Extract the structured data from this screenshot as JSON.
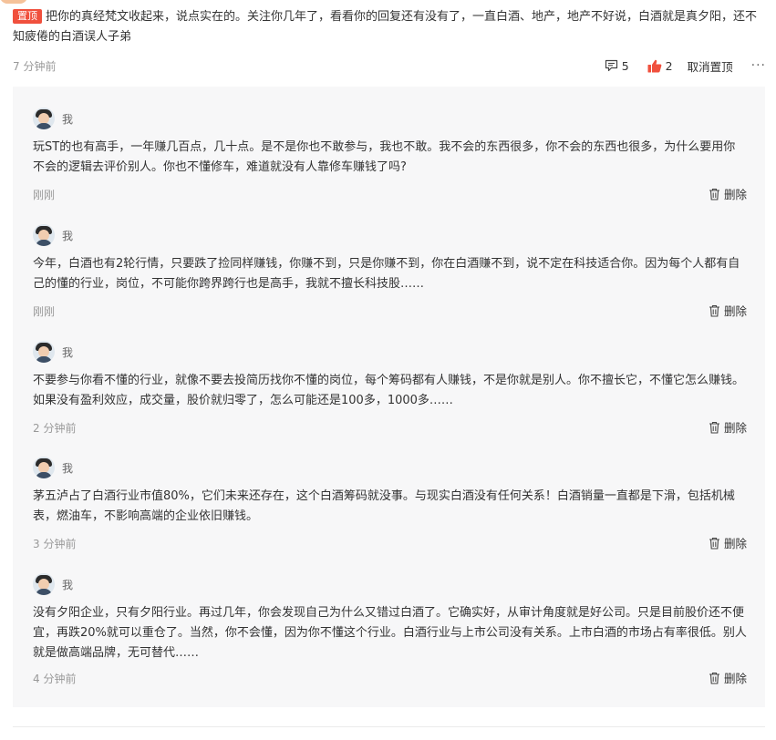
{
  "post": {
    "pin_label": "置顶",
    "text": "把你的真经梵文收起来，说点实在的。关注你几年了，看看你的回复还有没有了，一直白酒、地产，地产不好说，白酒就是真夕阳，还不知疲倦的白酒误人子弟",
    "time": "7 分钟前",
    "comment_count": "5",
    "like_count": "2",
    "unpin_label": "取消置顶",
    "more_label": "···",
    "icons": {
      "comment": "comment-icon",
      "like": "thumbs-up-icon",
      "more": "more-dots-icon"
    },
    "like_color": "#f0503d"
  },
  "replies": [
    {
      "name": "我",
      "text": "玩ST的也有高手，一年赚几百点，几十点。是不是你也不敢参与，我也不敢。我不会的东西很多，你不会的东西也很多，为什么要用你不会的逻辑去评价别人。你也不懂修车，难道就没有人靠修车赚钱了吗?",
      "time": "刚刚",
      "delete_label": "删除"
    },
    {
      "name": "我",
      "text": "今年，白酒也有2轮行情，只要跌了捡同样赚钱，你赚不到，只是你赚不到，你在白酒赚不到，说不定在科技适合你。因为每个人都有自己的懂的行业，岗位，不可能你跨界跨行也是高手，我就不擅长科技股……",
      "time": "刚刚",
      "delete_label": "删除"
    },
    {
      "name": "我",
      "text": "不要参与你看不懂的行业，就像不要去投简历找你不懂的岗位，每个筹码都有人赚钱，不是你就是别人。你不擅长它，不懂它怎么赚钱。如果没有盈利效应，成交量，股价就归零了，怎么可能还是100多，1000多……",
      "time": "2 分钟前",
      "delete_label": "删除"
    },
    {
      "name": "我",
      "text": "茅五泸占了白酒行业市值80%，它们未来还存在，这个白酒筹码就没事。与现实白酒没有任何关系！白酒销量一直都是下滑，包括机械表，燃油车，不影响高端的企业依旧赚钱。",
      "time": "3 分钟前",
      "delete_label": "删除"
    },
    {
      "name": "我",
      "text": "没有夕阳企业，只有夕阳行业。再过几年，你会发现自己为什么又错过白酒了。它确实好，从审计角度就是好公司。只是目前股价还不便宜，再跌20%就可以重仓了。当然，你不会懂，因为你不懂这个行业。白酒行业与上市公司没有关系。上市白酒的市场占有率很低。别人就是做高端品牌，无可替代……",
      "time": "4 分钟前",
      "delete_label": "删除"
    }
  ]
}
